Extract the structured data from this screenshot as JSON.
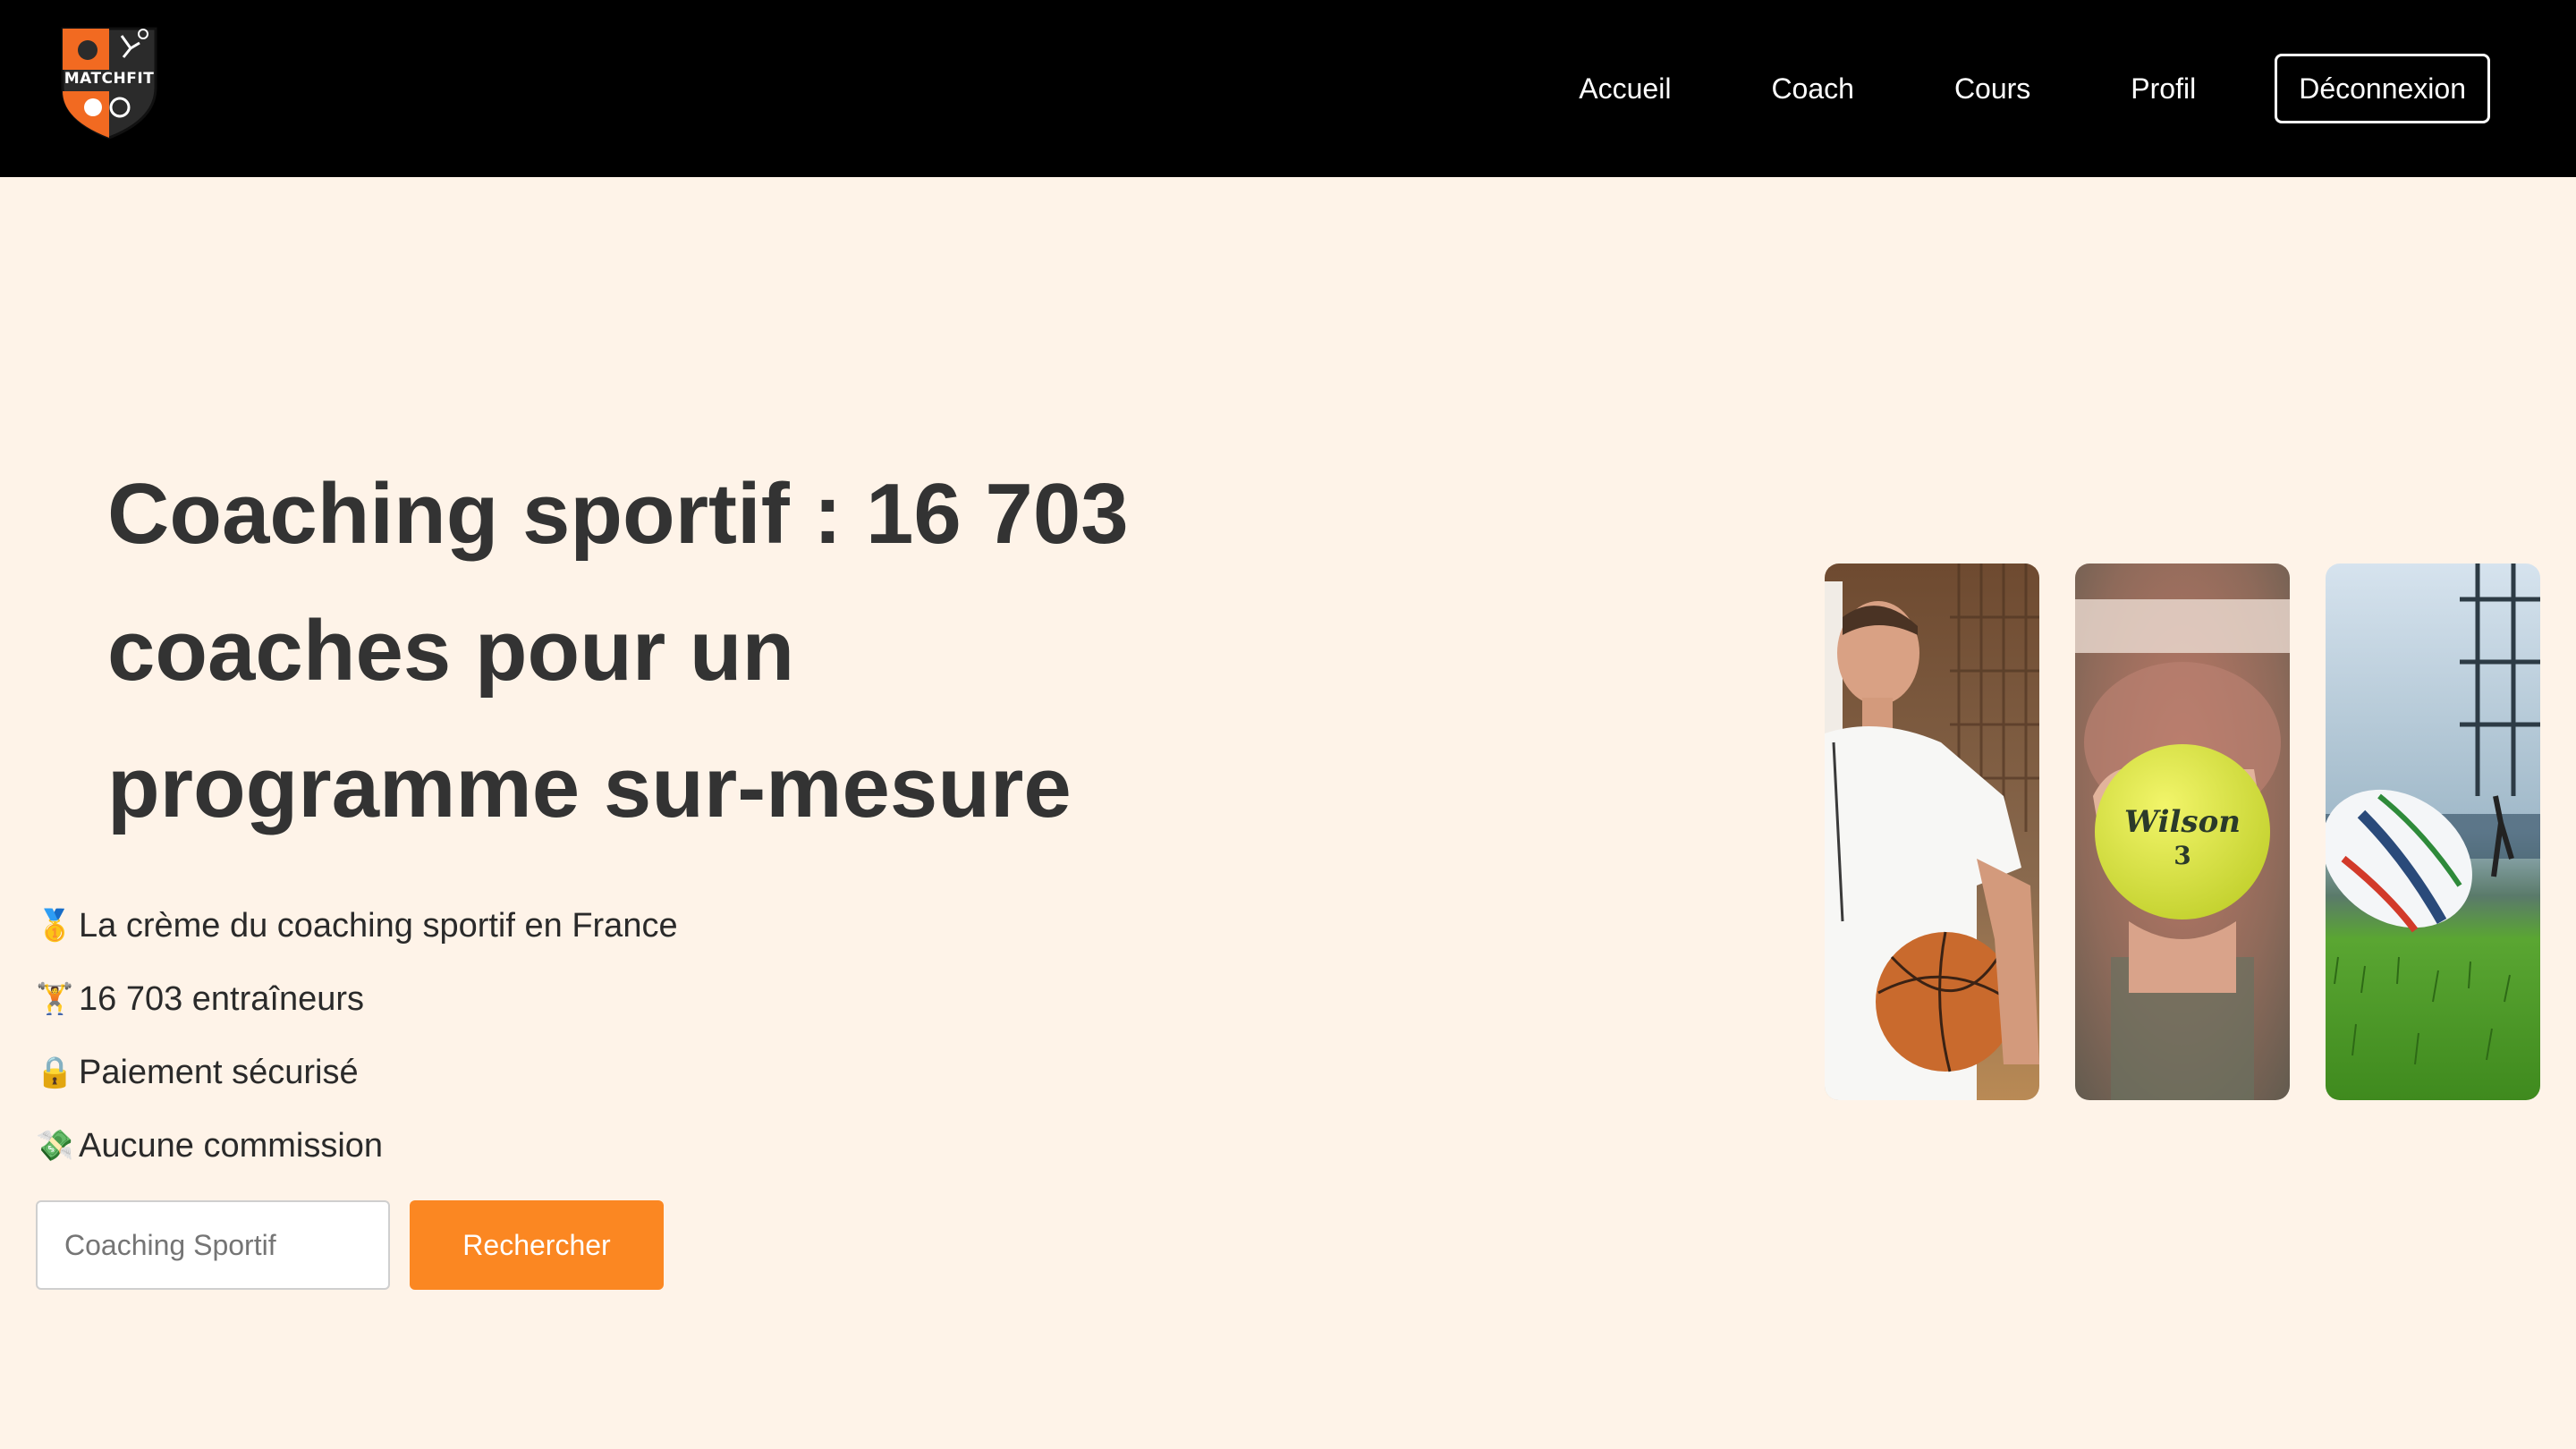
{
  "brand": {
    "name": "MATCHFIT",
    "colors": {
      "accent": "#fb8722",
      "nav_bg": "#000000",
      "page_bg": "#fef3e8",
      "text": "#333333"
    }
  },
  "nav": {
    "links": [
      "Accueil",
      "Coach",
      "Cours",
      "Profil"
    ],
    "logout_label": "Déconnexion"
  },
  "hero": {
    "title": "Coaching sportif : 16 703 coaches pour un programme sur-mesure",
    "features": [
      {
        "emoji": "🥇",
        "icon": "gold-medal-icon",
        "text": "La crème du coaching sportif en France"
      },
      {
        "emoji": "🏋️",
        "icon": "weightlifter-icon",
        "text": "16 703 entraîneurs"
      },
      {
        "emoji": "🔒",
        "icon": "lock-icon",
        "text": "Paiement sécurisé"
      },
      {
        "emoji": "💸",
        "icon": "money-wings-icon",
        "text": "Aucune commission"
      }
    ]
  },
  "search": {
    "placeholder": "Coaching Sportif",
    "value": "",
    "button_label": "Rechercher"
  },
  "images": [
    {
      "subject": "basketball-coach-photo"
    },
    {
      "subject": "tennis-ball-photo",
      "ball_text": "Wilson",
      "ball_number": "3"
    },
    {
      "subject": "rugby-ball-photo"
    }
  ]
}
